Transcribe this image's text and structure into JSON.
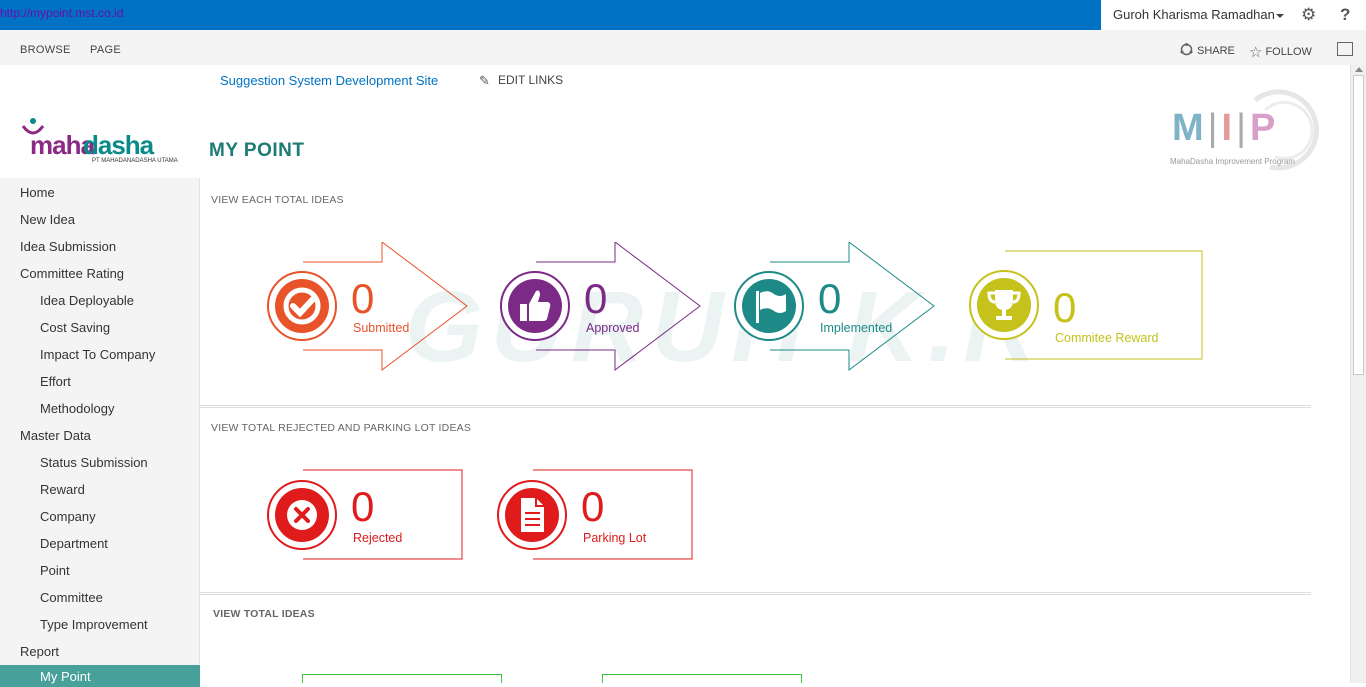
{
  "suite": {
    "url": "http://mypoint.mst.co.id",
    "user": "Guroh Kharisma Ramadhan"
  },
  "ribbon": {
    "browse": "BROWSE",
    "page": "PAGE",
    "share": "SHARE",
    "follow": "FOLLOW"
  },
  "topnav": {
    "site": "Suggestion System Development Site",
    "edit": "EDIT LINKS"
  },
  "logo": {
    "part1": "maha",
    "part2": "dasha",
    "tagline": "PT MAHADANADASHA UTAMA"
  },
  "mip": {
    "letters": "M|I|P",
    "tagline": "MahaDasha Improvement Program"
  },
  "page_title": "MY POINT",
  "sidebar": {
    "items": [
      {
        "label": "Home"
      },
      {
        "label": "New Idea"
      },
      {
        "label": "Idea Submission"
      },
      {
        "label": "Committee Rating"
      },
      {
        "label": "Idea Deployable"
      },
      {
        "label": "Cost Saving"
      },
      {
        "label": "Impact To Company"
      },
      {
        "label": "Effort"
      },
      {
        "label": "Methodology"
      },
      {
        "label": "Master Data"
      },
      {
        "label": "Status Submission"
      },
      {
        "label": "Reward"
      },
      {
        "label": "Company"
      },
      {
        "label": "Department"
      },
      {
        "label": "Point"
      },
      {
        "label": "Committee"
      },
      {
        "label": "Type Improvement"
      },
      {
        "label": "Report"
      },
      {
        "label": "My Point"
      }
    ]
  },
  "sections": {
    "each_total": "VIEW EACH TOTAL IDEAS",
    "rejected_parking": "VIEW TOTAL REJECTED AND PARKING LOT IDEAS",
    "total": "VIEW TOTAL IDEAS"
  },
  "cards": {
    "submitted": {
      "value": "0",
      "label": "Submitted",
      "color": "#e8532a"
    },
    "approved": {
      "value": "0",
      "label": "Approved",
      "color": "#7b2a86"
    },
    "implemented": {
      "value": "0",
      "label": "Implemented",
      "color": "#1d8a88"
    },
    "reward": {
      "value": "0",
      "label": "Commitee Reward",
      "color": "#c5c21c"
    },
    "rejected": {
      "value": "0",
      "label": "Rejected",
      "color": "#e01b1b"
    },
    "parking": {
      "value": "0",
      "label": "Parking Lot",
      "color": "#e01b1b"
    }
  },
  "watermark": "GURUH K.R"
}
